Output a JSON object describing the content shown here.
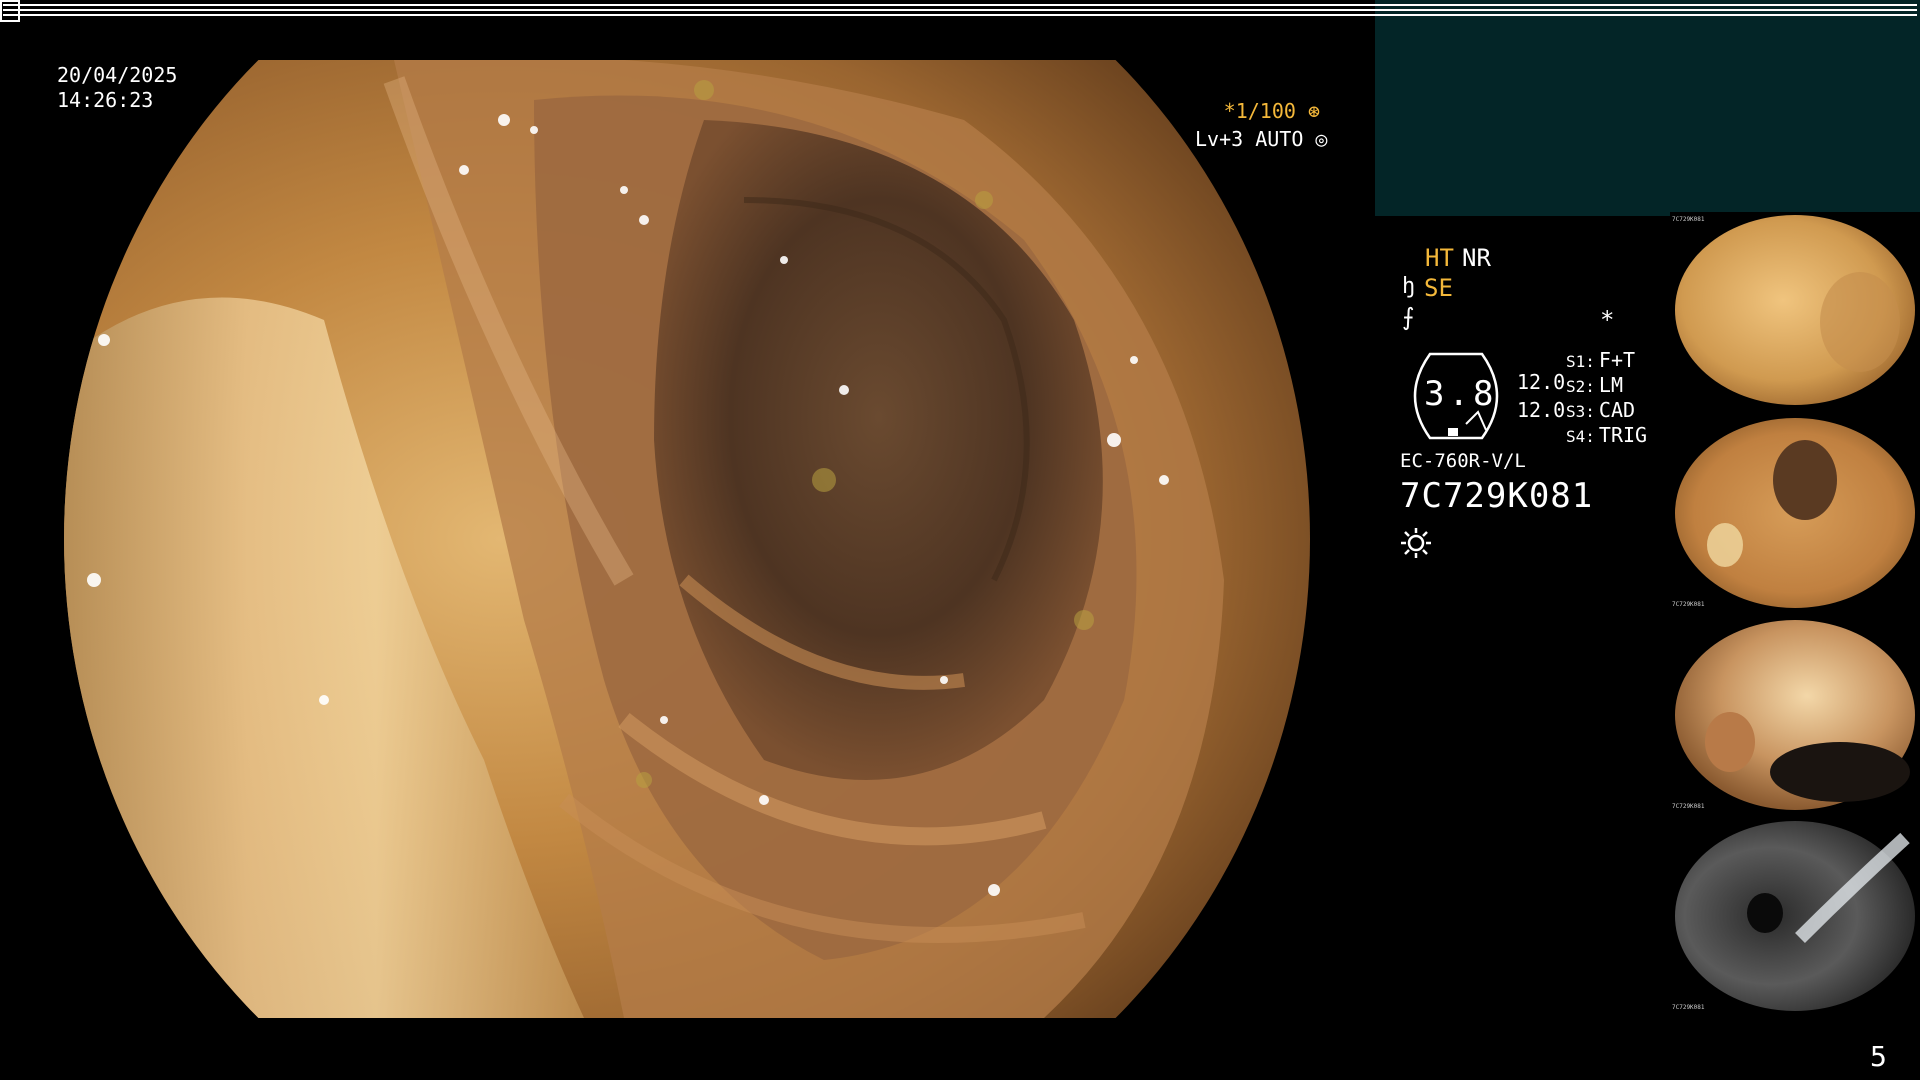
{
  "main_view": {
    "date": "20/04/2025",
    "time": "14:26:23",
    "shutter": "*1/100",
    "level": "Lv+3 AUTO"
  },
  "settings": {
    "ht": "HT",
    "nr": "NR",
    "se": "SE",
    "gauge_value": "3.8",
    "gauge_upper": "12.0",
    "gauge_lower": "12.0",
    "star": "*",
    "slots": [
      {
        "key": "S1:",
        "value": "F+T"
      },
      {
        "key": "S2:",
        "value": "LM"
      },
      {
        "key": "S3:",
        "value": "CAD"
      },
      {
        "key": "S4:",
        "value": "TRIG"
      }
    ]
  },
  "scope": {
    "model": "EC-760R-V/L",
    "serial": "7C729K081"
  },
  "thumbnails": [
    {
      "label": "7C729K081"
    },
    {
      "label": "7C729K081"
    },
    {
      "label": "7C729K081"
    },
    {
      "label": "7C729K081"
    }
  ],
  "page_number": "5"
}
